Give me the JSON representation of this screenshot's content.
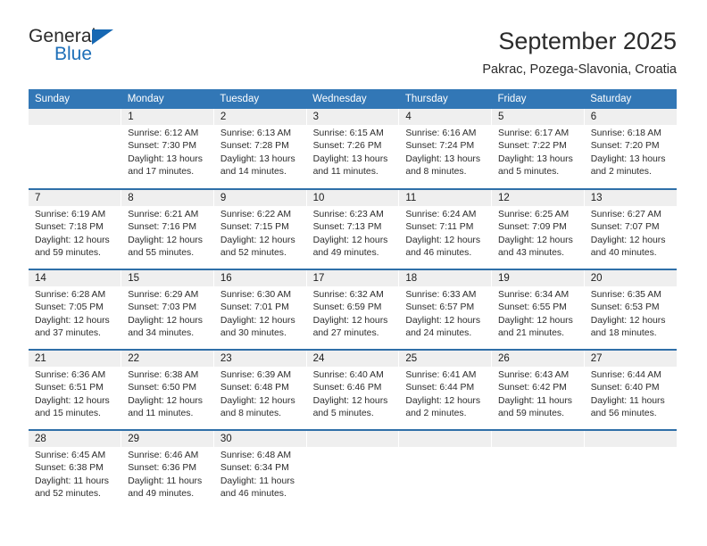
{
  "brand": {
    "name_part1": "General",
    "name_part2": "Blue",
    "triangle_color": "#1668b3",
    "blue_text_color": "#1d6fb8"
  },
  "header": {
    "title": "September 2025",
    "subtitle": "Pakrac, Pozega-Slavonia, Croatia"
  },
  "theme": {
    "header_bg": "#3277b6",
    "week_separator": "#2f6fa8",
    "daynum_bg": "#efefef"
  },
  "columns": [
    "Sunday",
    "Monday",
    "Tuesday",
    "Wednesday",
    "Thursday",
    "Friday",
    "Saturday"
  ],
  "weeks": [
    [
      {
        "day": "",
        "sunrise": "",
        "sunset": "",
        "daylight_line1": "",
        "daylight_line2": ""
      },
      {
        "day": "1",
        "sunrise": "Sunrise: 6:12 AM",
        "sunset": "Sunset: 7:30 PM",
        "daylight_line1": "Daylight: 13 hours",
        "daylight_line2": "and 17 minutes."
      },
      {
        "day": "2",
        "sunrise": "Sunrise: 6:13 AM",
        "sunset": "Sunset: 7:28 PM",
        "daylight_line1": "Daylight: 13 hours",
        "daylight_line2": "and 14 minutes."
      },
      {
        "day": "3",
        "sunrise": "Sunrise: 6:15 AM",
        "sunset": "Sunset: 7:26 PM",
        "daylight_line1": "Daylight: 13 hours",
        "daylight_line2": "and 11 minutes."
      },
      {
        "day": "4",
        "sunrise": "Sunrise: 6:16 AM",
        "sunset": "Sunset: 7:24 PM",
        "daylight_line1": "Daylight: 13 hours",
        "daylight_line2": "and 8 minutes."
      },
      {
        "day": "5",
        "sunrise": "Sunrise: 6:17 AM",
        "sunset": "Sunset: 7:22 PM",
        "daylight_line1": "Daylight: 13 hours",
        "daylight_line2": "and 5 minutes."
      },
      {
        "day": "6",
        "sunrise": "Sunrise: 6:18 AM",
        "sunset": "Sunset: 7:20 PM",
        "daylight_line1": "Daylight: 13 hours",
        "daylight_line2": "and 2 minutes."
      }
    ],
    [
      {
        "day": "7",
        "sunrise": "Sunrise: 6:19 AM",
        "sunset": "Sunset: 7:18 PM",
        "daylight_line1": "Daylight: 12 hours",
        "daylight_line2": "and 59 minutes."
      },
      {
        "day": "8",
        "sunrise": "Sunrise: 6:21 AM",
        "sunset": "Sunset: 7:16 PM",
        "daylight_line1": "Daylight: 12 hours",
        "daylight_line2": "and 55 minutes."
      },
      {
        "day": "9",
        "sunrise": "Sunrise: 6:22 AM",
        "sunset": "Sunset: 7:15 PM",
        "daylight_line1": "Daylight: 12 hours",
        "daylight_line2": "and 52 minutes."
      },
      {
        "day": "10",
        "sunrise": "Sunrise: 6:23 AM",
        "sunset": "Sunset: 7:13 PM",
        "daylight_line1": "Daylight: 12 hours",
        "daylight_line2": "and 49 minutes."
      },
      {
        "day": "11",
        "sunrise": "Sunrise: 6:24 AM",
        "sunset": "Sunset: 7:11 PM",
        "daylight_line1": "Daylight: 12 hours",
        "daylight_line2": "and 46 minutes."
      },
      {
        "day": "12",
        "sunrise": "Sunrise: 6:25 AM",
        "sunset": "Sunset: 7:09 PM",
        "daylight_line1": "Daylight: 12 hours",
        "daylight_line2": "and 43 minutes."
      },
      {
        "day": "13",
        "sunrise": "Sunrise: 6:27 AM",
        "sunset": "Sunset: 7:07 PM",
        "daylight_line1": "Daylight: 12 hours",
        "daylight_line2": "and 40 minutes."
      }
    ],
    [
      {
        "day": "14",
        "sunrise": "Sunrise: 6:28 AM",
        "sunset": "Sunset: 7:05 PM",
        "daylight_line1": "Daylight: 12 hours",
        "daylight_line2": "and 37 minutes."
      },
      {
        "day": "15",
        "sunrise": "Sunrise: 6:29 AM",
        "sunset": "Sunset: 7:03 PM",
        "daylight_line1": "Daylight: 12 hours",
        "daylight_line2": "and 34 minutes."
      },
      {
        "day": "16",
        "sunrise": "Sunrise: 6:30 AM",
        "sunset": "Sunset: 7:01 PM",
        "daylight_line1": "Daylight: 12 hours",
        "daylight_line2": "and 30 minutes."
      },
      {
        "day": "17",
        "sunrise": "Sunrise: 6:32 AM",
        "sunset": "Sunset: 6:59 PM",
        "daylight_line1": "Daylight: 12 hours",
        "daylight_line2": "and 27 minutes."
      },
      {
        "day": "18",
        "sunrise": "Sunrise: 6:33 AM",
        "sunset": "Sunset: 6:57 PM",
        "daylight_line1": "Daylight: 12 hours",
        "daylight_line2": "and 24 minutes."
      },
      {
        "day": "19",
        "sunrise": "Sunrise: 6:34 AM",
        "sunset": "Sunset: 6:55 PM",
        "daylight_line1": "Daylight: 12 hours",
        "daylight_line2": "and 21 minutes."
      },
      {
        "day": "20",
        "sunrise": "Sunrise: 6:35 AM",
        "sunset": "Sunset: 6:53 PM",
        "daylight_line1": "Daylight: 12 hours",
        "daylight_line2": "and 18 minutes."
      }
    ],
    [
      {
        "day": "21",
        "sunrise": "Sunrise: 6:36 AM",
        "sunset": "Sunset: 6:51 PM",
        "daylight_line1": "Daylight: 12 hours",
        "daylight_line2": "and 15 minutes."
      },
      {
        "day": "22",
        "sunrise": "Sunrise: 6:38 AM",
        "sunset": "Sunset: 6:50 PM",
        "daylight_line1": "Daylight: 12 hours",
        "daylight_line2": "and 11 minutes."
      },
      {
        "day": "23",
        "sunrise": "Sunrise: 6:39 AM",
        "sunset": "Sunset: 6:48 PM",
        "daylight_line1": "Daylight: 12 hours",
        "daylight_line2": "and 8 minutes."
      },
      {
        "day": "24",
        "sunrise": "Sunrise: 6:40 AM",
        "sunset": "Sunset: 6:46 PM",
        "daylight_line1": "Daylight: 12 hours",
        "daylight_line2": "and 5 minutes."
      },
      {
        "day": "25",
        "sunrise": "Sunrise: 6:41 AM",
        "sunset": "Sunset: 6:44 PM",
        "daylight_line1": "Daylight: 12 hours",
        "daylight_line2": "and 2 minutes."
      },
      {
        "day": "26",
        "sunrise": "Sunrise: 6:43 AM",
        "sunset": "Sunset: 6:42 PM",
        "daylight_line1": "Daylight: 11 hours",
        "daylight_line2": "and 59 minutes."
      },
      {
        "day": "27",
        "sunrise": "Sunrise: 6:44 AM",
        "sunset": "Sunset: 6:40 PM",
        "daylight_line1": "Daylight: 11 hours",
        "daylight_line2": "and 56 minutes."
      }
    ],
    [
      {
        "day": "28",
        "sunrise": "Sunrise: 6:45 AM",
        "sunset": "Sunset: 6:38 PM",
        "daylight_line1": "Daylight: 11 hours",
        "daylight_line2": "and 52 minutes."
      },
      {
        "day": "29",
        "sunrise": "Sunrise: 6:46 AM",
        "sunset": "Sunset: 6:36 PM",
        "daylight_line1": "Daylight: 11 hours",
        "daylight_line2": "and 49 minutes."
      },
      {
        "day": "30",
        "sunrise": "Sunrise: 6:48 AM",
        "sunset": "Sunset: 6:34 PM",
        "daylight_line1": "Daylight: 11 hours",
        "daylight_line2": "and 46 minutes."
      },
      {
        "day": "",
        "sunrise": "",
        "sunset": "",
        "daylight_line1": "",
        "daylight_line2": ""
      },
      {
        "day": "",
        "sunrise": "",
        "sunset": "",
        "daylight_line1": "",
        "daylight_line2": ""
      },
      {
        "day": "",
        "sunrise": "",
        "sunset": "",
        "daylight_line1": "",
        "daylight_line2": ""
      },
      {
        "day": "",
        "sunrise": "",
        "sunset": "",
        "daylight_line1": "",
        "daylight_line2": ""
      }
    ]
  ]
}
